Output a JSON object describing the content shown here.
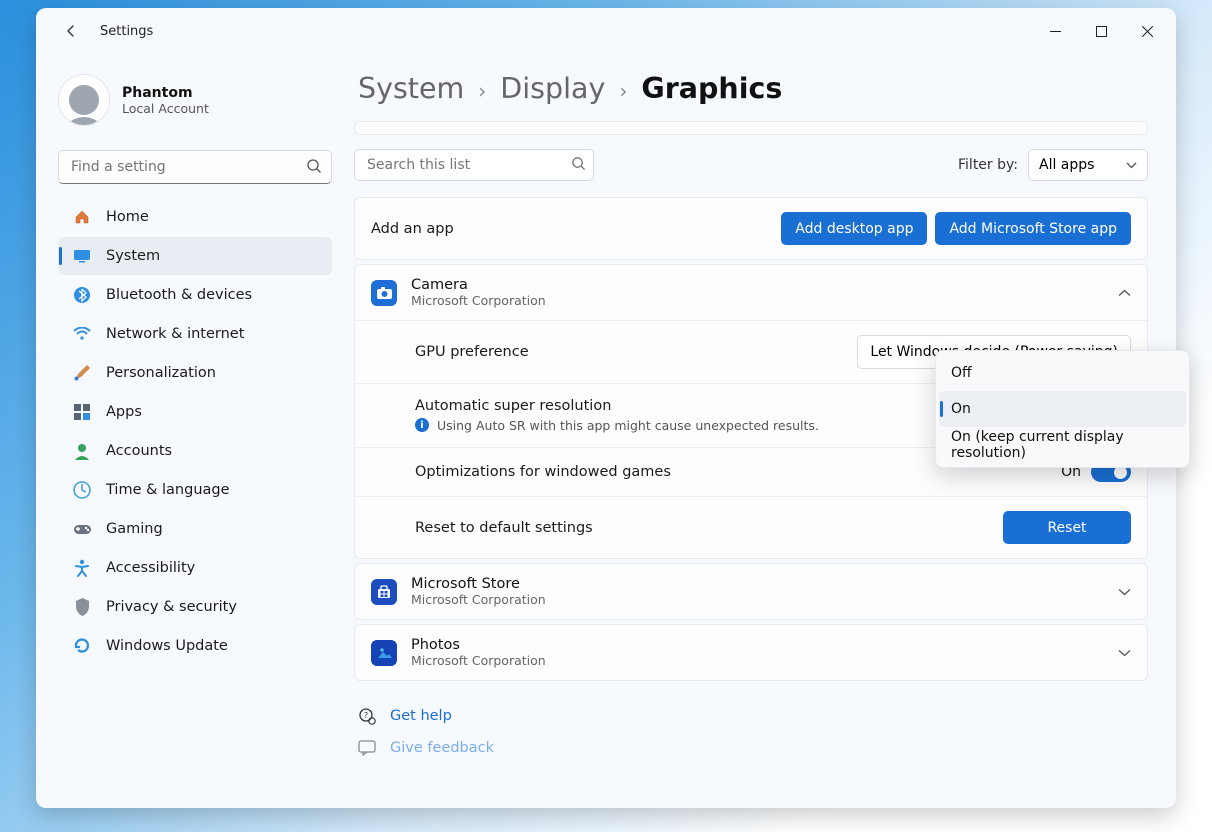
{
  "window": {
    "title": "Settings"
  },
  "profile": {
    "name": "Phantom",
    "sub": "Local Account"
  },
  "sidebar_search_placeholder": "Find a setting",
  "nav": [
    {
      "label": "Home"
    },
    {
      "label": "System"
    },
    {
      "label": "Bluetooth & devices"
    },
    {
      "label": "Network & internet"
    },
    {
      "label": "Personalization"
    },
    {
      "label": "Apps"
    },
    {
      "label": "Accounts"
    },
    {
      "label": "Time & language"
    },
    {
      "label": "Gaming"
    },
    {
      "label": "Accessibility"
    },
    {
      "label": "Privacy & security"
    },
    {
      "label": "Windows Update"
    }
  ],
  "breadcrumb": {
    "a": "System",
    "b": "Display",
    "c": "Graphics"
  },
  "list_search_placeholder": "Search this list",
  "filter": {
    "label": "Filter by:",
    "value": "All apps"
  },
  "add_app": {
    "label": "Add an app",
    "desktop_btn": "Add desktop app",
    "store_btn": "Add Microsoft Store app"
  },
  "apps": {
    "camera": {
      "name": "Camera",
      "publisher": "Microsoft Corporation"
    },
    "store": {
      "name": "Microsoft Store",
      "publisher": "Microsoft Corporation"
    },
    "photos": {
      "name": "Photos",
      "publisher": "Microsoft Corporation"
    }
  },
  "camera_rows": {
    "gpu_pref": {
      "label": "GPU preference",
      "value": "Let Windows decide (Power saving)"
    },
    "auto_sr": {
      "label": "Automatic super resolution",
      "desc": "Using Auto SR with this app might cause unexpected results."
    },
    "windowed": {
      "label": "Optimizations for windowed games",
      "state": "On"
    },
    "reset": {
      "label": "Reset to default settings",
      "btn": "Reset"
    }
  },
  "popup": {
    "off": "Off",
    "on": "On",
    "on_keep": "On (keep current display resolution)"
  },
  "footer": {
    "help": "Get help",
    "feedback": "Give feedback"
  }
}
